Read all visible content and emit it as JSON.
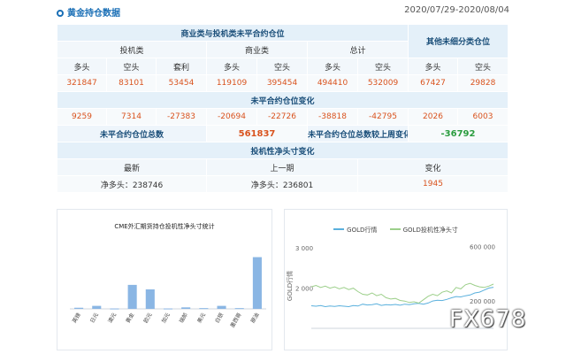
{
  "header": {
    "title": "黄金持仓数据",
    "date_range": "2020/07/29-2020/08/04"
  },
  "table": {
    "group1": "商业类与投机类未平合约仓位",
    "group2": "其他未细分类仓位",
    "spec": "投机类",
    "comm": "商业类",
    "total": "总计",
    "cols": [
      "多头",
      "空头",
      "套利",
      "多头",
      "空头",
      "多头",
      "空头",
      "多头",
      "空头"
    ],
    "values": [
      "321847",
      "83101",
      "53454",
      "119109",
      "395454",
      "494410",
      "532009",
      "67427",
      "29828"
    ],
    "change_title": "未平合约仓位变化",
    "changes": [
      "9259",
      "7314",
      "-27383",
      "-20694",
      "-22726",
      "-38818",
      "-42795",
      "2026",
      "6003"
    ],
    "oi_label": "未平合约仓位总数",
    "oi_value": "561837",
    "oi_change_label": "未平合约仓位总数较上周变化",
    "oi_change_value": "-36792",
    "net_title": "投机性净头寸变化",
    "latest": "最新",
    "prev": "上一期",
    "chg": "变化",
    "latest_val": "净多头：238746",
    "prev_val": "净多头：236801",
    "chg_val": "1945"
  },
  "chart_data": [
    {
      "type": "bar",
      "title": "CME外汇期货持仓投机性净头寸统计",
      "categories": [
        "英镑",
        "日元",
        "澳元",
        "黄金",
        "欧元",
        "加元",
        "瑞郎",
        "美元",
        "白银",
        "墨西哥",
        "原油"
      ],
      "values": [
        1.5,
        4,
        0.5,
        32,
        26,
        0.5,
        2,
        1,
        4,
        1,
        69
      ],
      "ylim": [
        0,
        85
      ]
    },
    {
      "type": "line",
      "series": [
        {
          "name": "GOLD行情",
          "color": "#5ab0dd",
          "values": [
            1560,
            1550,
            1565,
            1540,
            1555,
            1545,
            1560,
            1550,
            1540,
            1565,
            1555,
            1600,
            1580,
            1590,
            1610,
            1570,
            1590,
            1580,
            1595,
            1575,
            1600,
            1590,
            1610,
            1620,
            1600,
            1630,
            1680,
            1700,
            1690,
            1720,
            1760,
            1790,
            1780,
            1810,
            1830,
            1880,
            1900,
            1950,
            2000,
            2020
          ]
        },
        {
          "name": "GOLD投机性净头寸",
          "color": "#9ccf8a",
          "values": [
            305000,
            315000,
            300000,
            310000,
            295000,
            305000,
            290000,
            300000,
            285000,
            295000,
            270000,
            250000,
            245000,
            260000,
            240000,
            250000,
            225000,
            215000,
            220000,
            205000,
            200000,
            190000,
            195000,
            185000,
            210000,
            235000,
            250000,
            240000,
            265000,
            275000,
            260000,
            300000,
            290000,
            320000,
            330000,
            315000,
            305000,
            300000,
            310000,
            325000
          ]
        }
      ],
      "left_axis": {
        "label": "GOLD行情",
        "ticks": [
          "3 000",
          "2 000"
        ]
      },
      "right_axis": {
        "ticks": [
          "600 000",
          "200 000"
        ]
      },
      "ylim_left": [
        1000,
        3200
      ],
      "ylim_right": [
        0,
        650000
      ]
    }
  ],
  "watermark": "FX678"
}
